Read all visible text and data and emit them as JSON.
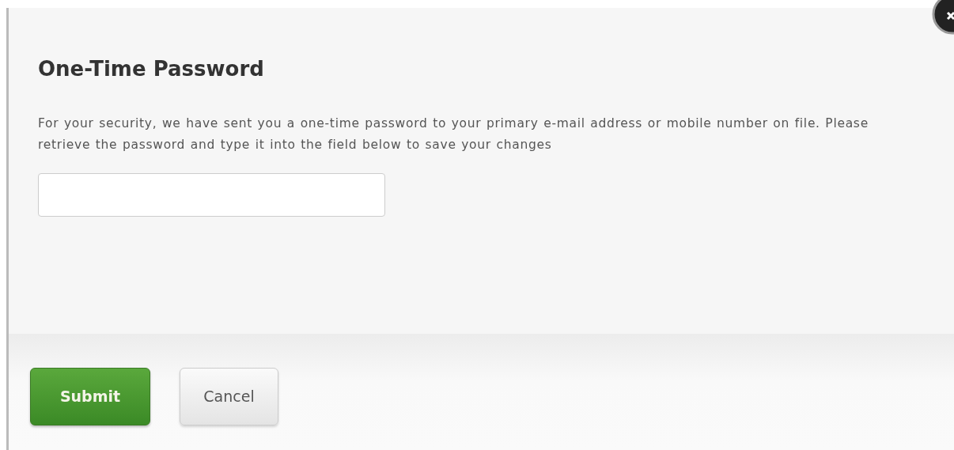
{
  "dialog": {
    "title": "One-Time Password",
    "message": "For your security, we have sent you a one-time password to your primary e-mail address or mobile number on file. Please retrieve the password and type it into the field below to save your changes",
    "buttons": [
      {
        "label": "Submit",
        "kind": "primary"
      },
      {
        "label": "Cancel",
        "kind": "secondary"
      }
    ]
  }
}
